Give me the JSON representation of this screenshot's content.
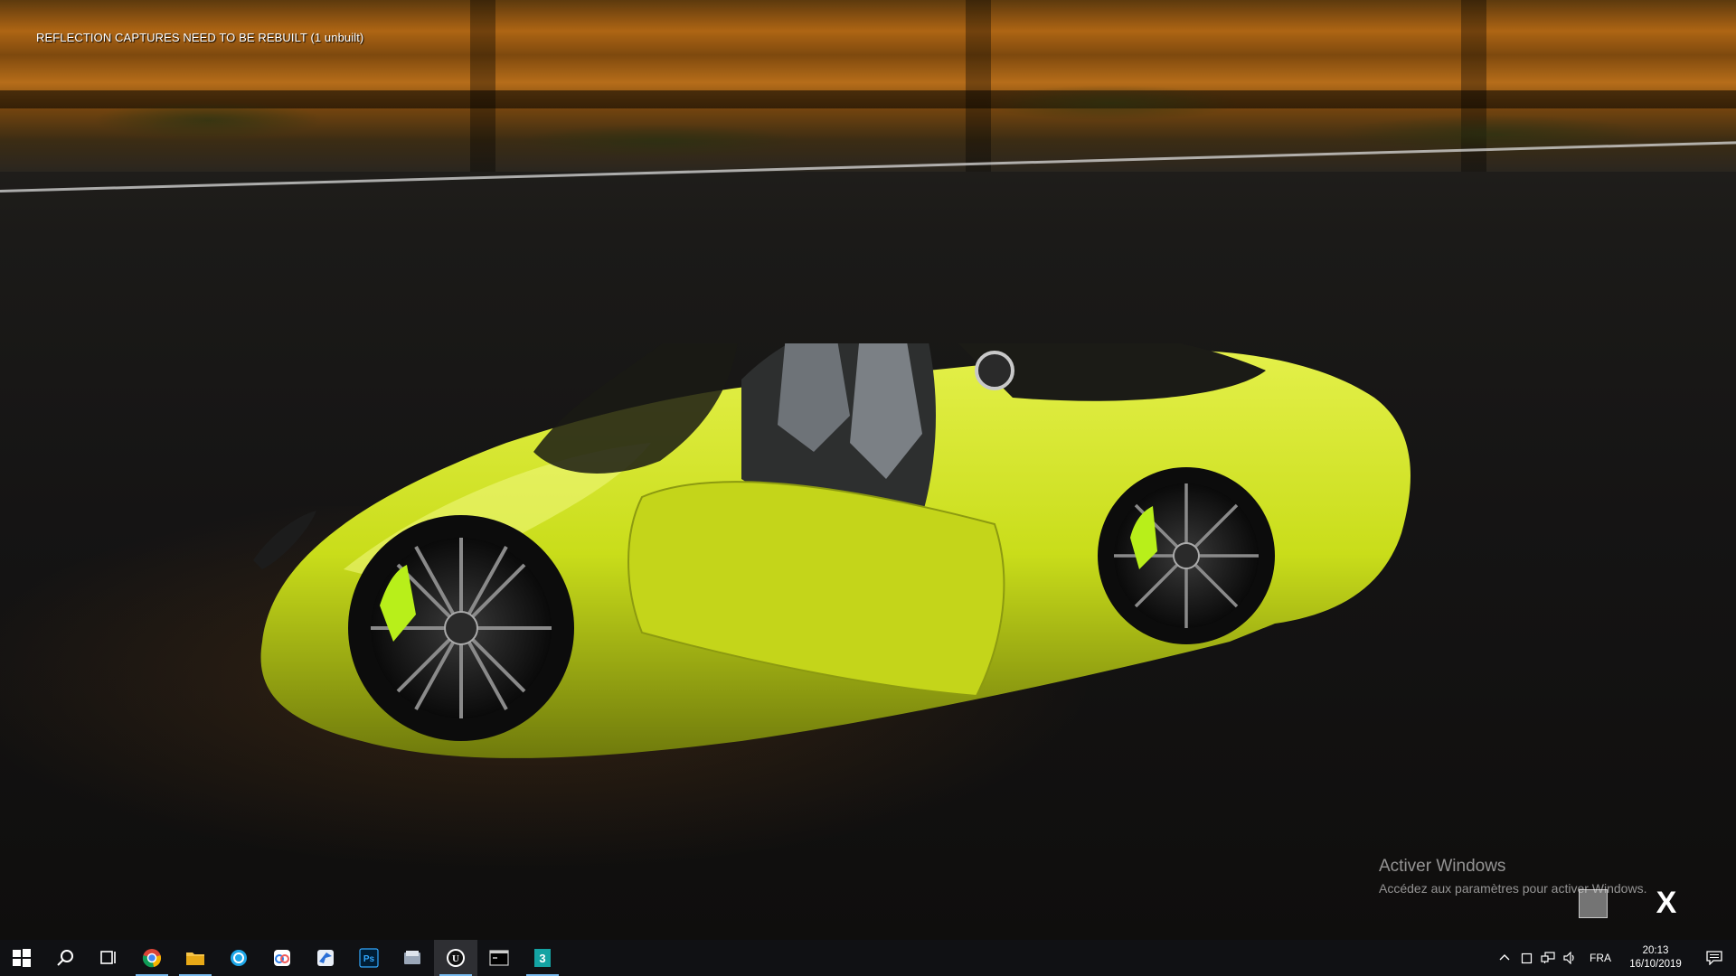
{
  "viewport": {
    "warning": "REFLECTION CAPTURES NEED TO BE REBUILT (1 unbuilt)",
    "car_color": "#c9dd1a"
  },
  "watermark": {
    "title": "Activer Windows",
    "subtitle": "Accédez aux paramètres pour activer Windows."
  },
  "overlay": {
    "close_label": "X"
  },
  "taskbar": {
    "color": "#101114",
    "accent": "#76b9ed",
    "apps": [
      {
        "name": "start-icon"
      },
      {
        "name": "search-icon"
      },
      {
        "name": "task-view-icon"
      },
      {
        "name": "chrome-icon"
      },
      {
        "name": "file-explorer-icon"
      },
      {
        "name": "app-blue-icon"
      },
      {
        "name": "app-cloud-icon"
      },
      {
        "name": "app-bird-icon"
      },
      {
        "name": "photoshop-icon",
        "label": "Ps"
      },
      {
        "name": "app-folder-icon"
      },
      {
        "name": "unreal-engine-icon",
        "label": "U"
      },
      {
        "name": "terminal-icon"
      },
      {
        "name": "3ds-max-icon",
        "label": "3"
      }
    ],
    "tray": {
      "language": "FRA",
      "time": "20:13",
      "date": "16/10/2019"
    }
  }
}
